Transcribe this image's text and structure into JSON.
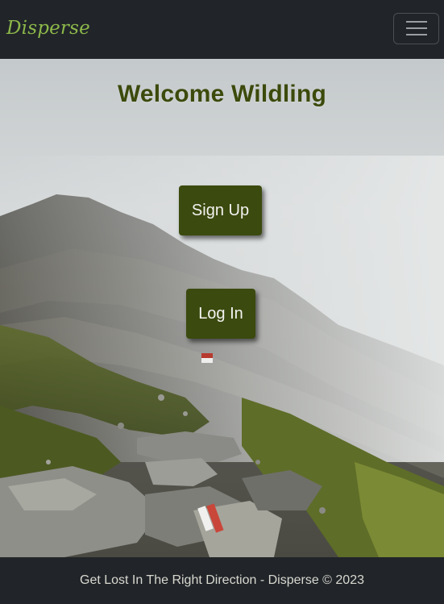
{
  "navbar": {
    "brand": "Disperse",
    "toggler_icon": "hamburger-menu-icon"
  },
  "hero": {
    "title": "Welcome Wildling",
    "signup_label": "Sign Up",
    "login_label": "Log In",
    "background_image": "misty mountain trail"
  },
  "footer": {
    "text": "Get Lost In The Right Direction - Disperse © 2023"
  },
  "colors": {
    "navbar_bg": "#212529",
    "brand": "#8db84a",
    "title": "#3c4a0c",
    "button_bg": "#3b4a0e",
    "button_text": "#f3f3f0",
    "footer_text": "#d8d8d0"
  }
}
